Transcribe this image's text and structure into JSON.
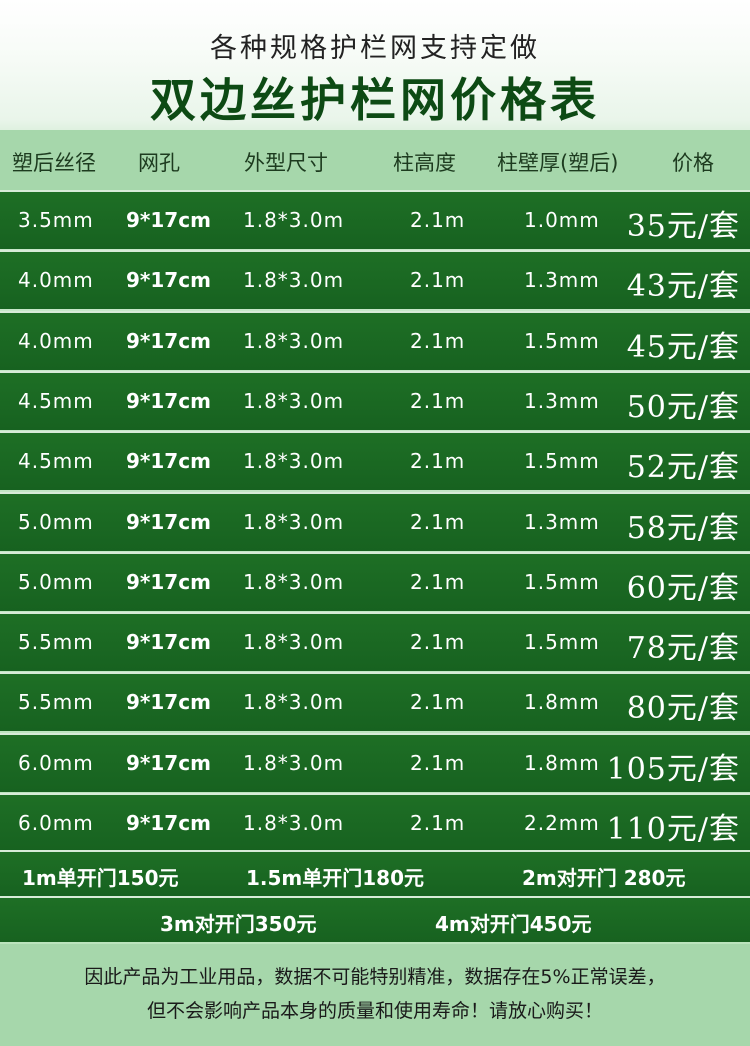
{
  "header": {
    "subtitle": "各种规格护栏网支持定做",
    "title": "双边丝护栏网价格表"
  },
  "table": {
    "columns": [
      "塑后丝径",
      "网孔",
      "外型尺寸",
      "柱高度",
      "柱壁厚(塑后)",
      "价格"
    ],
    "rows": [
      [
        "3.5mm",
        "9*17cm",
        "1.8*3.0m",
        "2.1m",
        "1.0mm",
        "35元/套"
      ],
      [
        "4.0mm",
        "9*17cm",
        "1.8*3.0m",
        "2.1m",
        "1.3mm",
        "43元/套"
      ],
      [
        "4.0mm",
        "9*17cm",
        "1.8*3.0m",
        "2.1m",
        "1.5mm",
        "45元/套"
      ],
      [
        "4.5mm",
        "9*17cm",
        "1.8*3.0m",
        "2.1m",
        "1.3mm",
        "50元/套"
      ],
      [
        "4.5mm",
        "9*17cm",
        "1.8*3.0m",
        "2.1m",
        "1.5mm",
        "52元/套"
      ],
      [
        "5.0mm",
        "9*17cm",
        "1.8*3.0m",
        "2.1m",
        "1.3mm",
        "58元/套"
      ],
      [
        "5.0mm",
        "9*17cm",
        "1.8*3.0m",
        "2.1m",
        "1.5mm",
        "60元/套"
      ],
      [
        "5.5mm",
        "9*17cm",
        "1.8*3.0m",
        "2.1m",
        "1.5mm",
        "78元/套"
      ],
      [
        "5.5mm",
        "9*17cm",
        "1.8*3.0m",
        "2.1m",
        "1.8mm",
        "80元/套"
      ],
      [
        "6.0mm",
        "9*17cm",
        "1.8*3.0m",
        "2.1m",
        "1.8mm",
        "105元/套"
      ],
      [
        "6.0mm",
        "9*17cm",
        "1.8*3.0m",
        "2.1m",
        "2.2mm",
        "110元/套"
      ]
    ]
  },
  "doors": {
    "row1": [
      "1m单开门150元",
      "1.5m单开门180元",
      "2m对开门 280元"
    ],
    "row2": [
      "3m对开门350元",
      "4m对开门450元"
    ]
  },
  "notice": {
    "line1": "因此产品为工业用品，数据不可能特别精准，数据存在5%正常误差，",
    "line2": "但不会影响产品本身的质量和使用寿命！请放心购买！"
  },
  "colors": {
    "row_green": "#1e6f25",
    "header_green": "#a6d7ab",
    "title_green": "#0d4a14"
  }
}
